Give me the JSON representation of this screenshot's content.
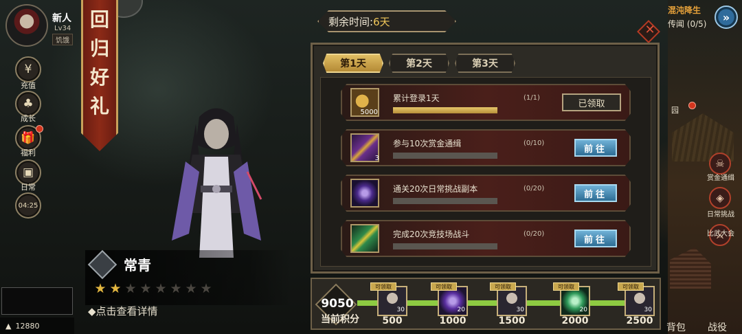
{
  "player": {
    "name": "新人",
    "level": "Lv34",
    "status": "饥饿"
  },
  "currency": {
    "icon": "coin-icon",
    "value": "12880"
  },
  "sidebar": {
    "items": [
      {
        "label": "充值",
        "icon": "yen-coin-icon"
      },
      {
        "label": "成长",
        "icon": "tree-icon"
      },
      {
        "label": "福利",
        "icon": "gift-icon",
        "badge": true
      },
      {
        "label": "日常",
        "icon": "chest-icon"
      },
      {
        "label": "04:25",
        "icon": "clock-icon"
      }
    ]
  },
  "banner": {
    "text": "回归好礼"
  },
  "character": {
    "name": "常青",
    "stars_filled": 2,
    "stars_total": 8,
    "detail_label": "◆点击查看详情"
  },
  "panel": {
    "remaining_prefix": "剩余时间:",
    "remaining_days": "6天",
    "tabs": [
      {
        "label": "第1天",
        "active": true
      },
      {
        "label": "第2天",
        "active": false
      },
      {
        "label": "第3天",
        "active": false
      }
    ],
    "tasks": [
      {
        "title": "累计登录1天",
        "progress_text": "(1/1)",
        "progress": 1.0,
        "icon": "coin-stack-icon",
        "count": "5000",
        "action": "已领取",
        "action_type": "claimed"
      },
      {
        "title": "参与10次赏金通缉",
        "progress_text": "(0/10)",
        "progress": 0.0,
        "icon": "scroll-icon",
        "count": "3",
        "action": "前往",
        "action_type": "go"
      },
      {
        "title": "通关20次日常挑战副本",
        "progress_text": "(0/20)",
        "progress": 0.0,
        "icon": "purple-crystal-icon",
        "count": "",
        "action": "前往",
        "action_type": "go"
      },
      {
        "title": "完成20次竞技场战斗",
        "progress_text": "(0/20)",
        "progress": 0.0,
        "icon": "green-scroll-icon",
        "count": "",
        "action": "前往",
        "action_type": "go"
      }
    ]
  },
  "rewards": {
    "points_value": "9050",
    "points_label": "当前积分",
    "items": [
      {
        "tag": "可领取",
        "threshold": "500",
        "qty": "30",
        "icon": "hero-portrait-icon"
      },
      {
        "tag": "可领取",
        "threshold": "1000",
        "qty": "20",
        "icon": "purple-crystal-icon"
      },
      {
        "tag": "可领取",
        "threshold": "1500",
        "qty": "30",
        "icon": "hero-portrait-icon"
      },
      {
        "tag": "可领取",
        "threshold": "2000",
        "qty": "20",
        "icon": "green-crystal-icon"
      },
      {
        "tag": "可领取",
        "threshold": "2500",
        "qty": "30",
        "icon": "hero-portrait-icon"
      }
    ]
  },
  "right_panel": {
    "quest_title": "混沌降生",
    "quest_subtitle": "传闻 (0/5)",
    "garden_label": "园",
    "buttons": [
      {
        "label": "赏金通缉",
        "icon": "skull-icon"
      },
      {
        "label": "日常挑战",
        "icon": "shield-icon"
      },
      {
        "label": "比武大会",
        "icon": "crossed-swords-icon"
      }
    ],
    "bag_label": "背包",
    "battle_label": "战役"
  },
  "colors": {
    "accent_gold": "#e0bd63",
    "go_button_blue": "#3c84b4",
    "progress_gold": "#d2ad50",
    "track_green": "#8ecb42",
    "alert_red": "#d2351e"
  }
}
